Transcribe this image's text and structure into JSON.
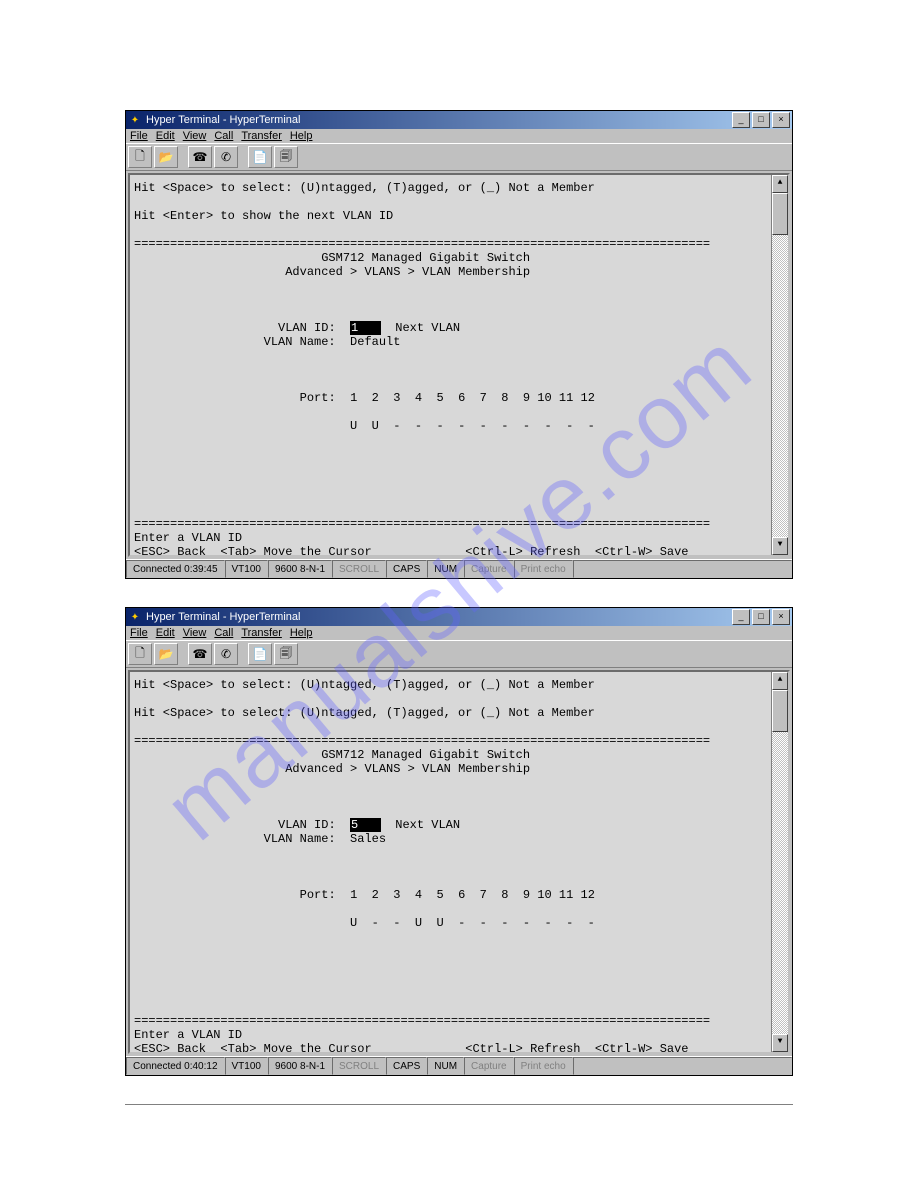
{
  "watermark_text": "manualshive.com",
  "windows": [
    {
      "title": "Hyper Terminal - HyperTerminal",
      "menu": [
        "File",
        "Edit",
        "View",
        "Call",
        "Transfer",
        "Help"
      ],
      "terminal": {
        "line_hint1": "Hit <Space> to select: (U)ntagged, (T)agged, or (_) Not a Member",
        "line_hint2": "Hit <Enter> to show the next VLAN ID",
        "header1": "GSM712 Managed Gigabit Switch",
        "header2": "Advanced > VLANS > VLAN Membership",
        "vlan_id_label": "VLAN ID:",
        "vlan_id_value": "1",
        "next_vlan": "Next VLAN",
        "vlan_name_label": "VLAN Name:",
        "vlan_name_value": "Default",
        "port_label": "Port:",
        "port_numbers": "1  2  3  4  5  6  7  8  9 10 11 12",
        "port_values": "U  U  -  -  -  -  -  -  -  -  -  -",
        "footer1": "Enter a VLAN ID",
        "footer2_left": "<ESC> Back  <Tab> Move the Cursor",
        "footer2_right": "<Ctrl-L> Refresh  <Ctrl-W> Save"
      },
      "status": {
        "connected": "Connected 0:39:45",
        "emulation": "VT100",
        "port": "9600 8-N-1",
        "scroll": "SCROLL",
        "caps": "CAPS",
        "num": "NUM",
        "capture": "Capture",
        "printecho": "Print echo"
      }
    },
    {
      "title": "Hyper Terminal - HyperTerminal",
      "menu": [
        "File",
        "Edit",
        "View",
        "Call",
        "Transfer",
        "Help"
      ],
      "terminal": {
        "line_hint1": "Hit <Space> to select: (U)ntagged, (T)agged, or (_) Not a Member",
        "line_hint2": "Hit <Space> to select: (U)ntagged, (T)agged, or (_) Not a Member",
        "header1": "GSM712 Managed Gigabit Switch",
        "header2": "Advanced > VLANS > VLAN Membership",
        "vlan_id_label": "VLAN ID:",
        "vlan_id_value": "5",
        "next_vlan": "Next VLAN",
        "vlan_name_label": "VLAN Name:",
        "vlan_name_value": "Sales",
        "port_label": "Port:",
        "port_numbers": "1  2  3  4  5  6  7  8  9 10 11 12",
        "port_values": "U  -  -  U  U  -  -  -  -  -  -  -",
        "footer1": "Enter a VLAN ID",
        "footer2_left": "<ESC> Back  <Tab> Move the Cursor",
        "footer2_right": "<Ctrl-L> Refresh  <Ctrl-W> Save"
      },
      "status": {
        "connected": "Connected 0:40:12",
        "emulation": "VT100",
        "port": "9600 8-N-1",
        "scroll": "SCROLL",
        "caps": "CAPS",
        "num": "NUM",
        "capture": "Capture",
        "printecho": "Print echo"
      }
    }
  ]
}
